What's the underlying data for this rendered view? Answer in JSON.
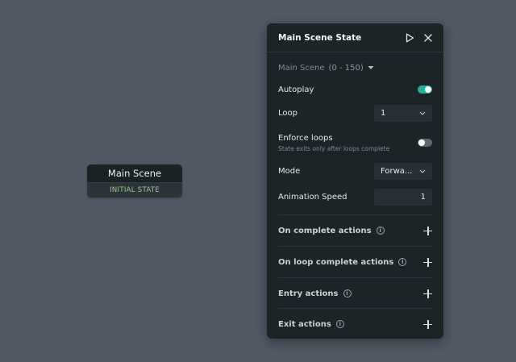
{
  "node": {
    "title": "Main Scene",
    "subtitle": "INITIAL STATE"
  },
  "panel": {
    "title": "Main Scene State",
    "scene_name": "Main Scene",
    "scene_range": "(0 - 150)",
    "autoplay": {
      "label": "Autoplay",
      "enabled": true
    },
    "loop": {
      "label": "Loop",
      "value": "1"
    },
    "enforce_loops": {
      "label": "Enforce loops",
      "description": "State exits only after loops complete",
      "enabled": false
    },
    "mode": {
      "label": "Mode",
      "value": "Forwa..."
    },
    "animation_speed": {
      "label": "Animation Speed",
      "value": "1"
    },
    "sections": [
      {
        "label": "On complete actions"
      },
      {
        "label": "On loop complete actions"
      },
      {
        "label": "Entry actions"
      },
      {
        "label": "Exit actions"
      }
    ]
  },
  "colors": {
    "canvas_bg": "#4f5863",
    "panel_bg": "#1c2428",
    "toggle_on": "#20b39a",
    "initial_state_text": "#9ccf8a"
  },
  "icons": {
    "play": "play-icon",
    "close": "close-icon",
    "dropdown": "caret-down-icon",
    "chevron": "chevron-down-icon",
    "info": "info-icon",
    "add": "plus-icon"
  }
}
